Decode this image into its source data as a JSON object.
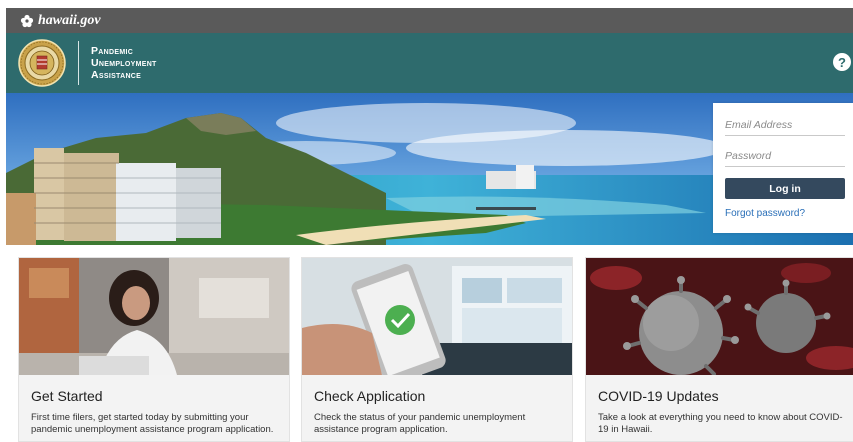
{
  "gov_bar": {
    "site_name": "hawaii.gov",
    "logo_icon": "hawaii-flower-icon"
  },
  "header": {
    "title_lines": [
      "Pandemic",
      "Unemployment",
      "Assistance"
    ],
    "seal_icon": "state-seal-icon",
    "help_label": "?",
    "color": "#2e6b6d"
  },
  "login": {
    "email_placeholder": "Email Address",
    "password_placeholder": "Password",
    "login_label": "Log in",
    "forgot_label": "Forgot password?",
    "button_color": "#34495e"
  },
  "cards": [
    {
      "title": "Get Started",
      "description": "First time filers, get started today by submitting your pandemic unemployment assistance program application."
    },
    {
      "title": "Check Application",
      "description": "Check the status of your pandemic unemployment assistance program application."
    },
    {
      "title": "COVID-19 Updates",
      "description": "Take a look at everything you need to know about COVID-19 in Hawaii."
    }
  ]
}
